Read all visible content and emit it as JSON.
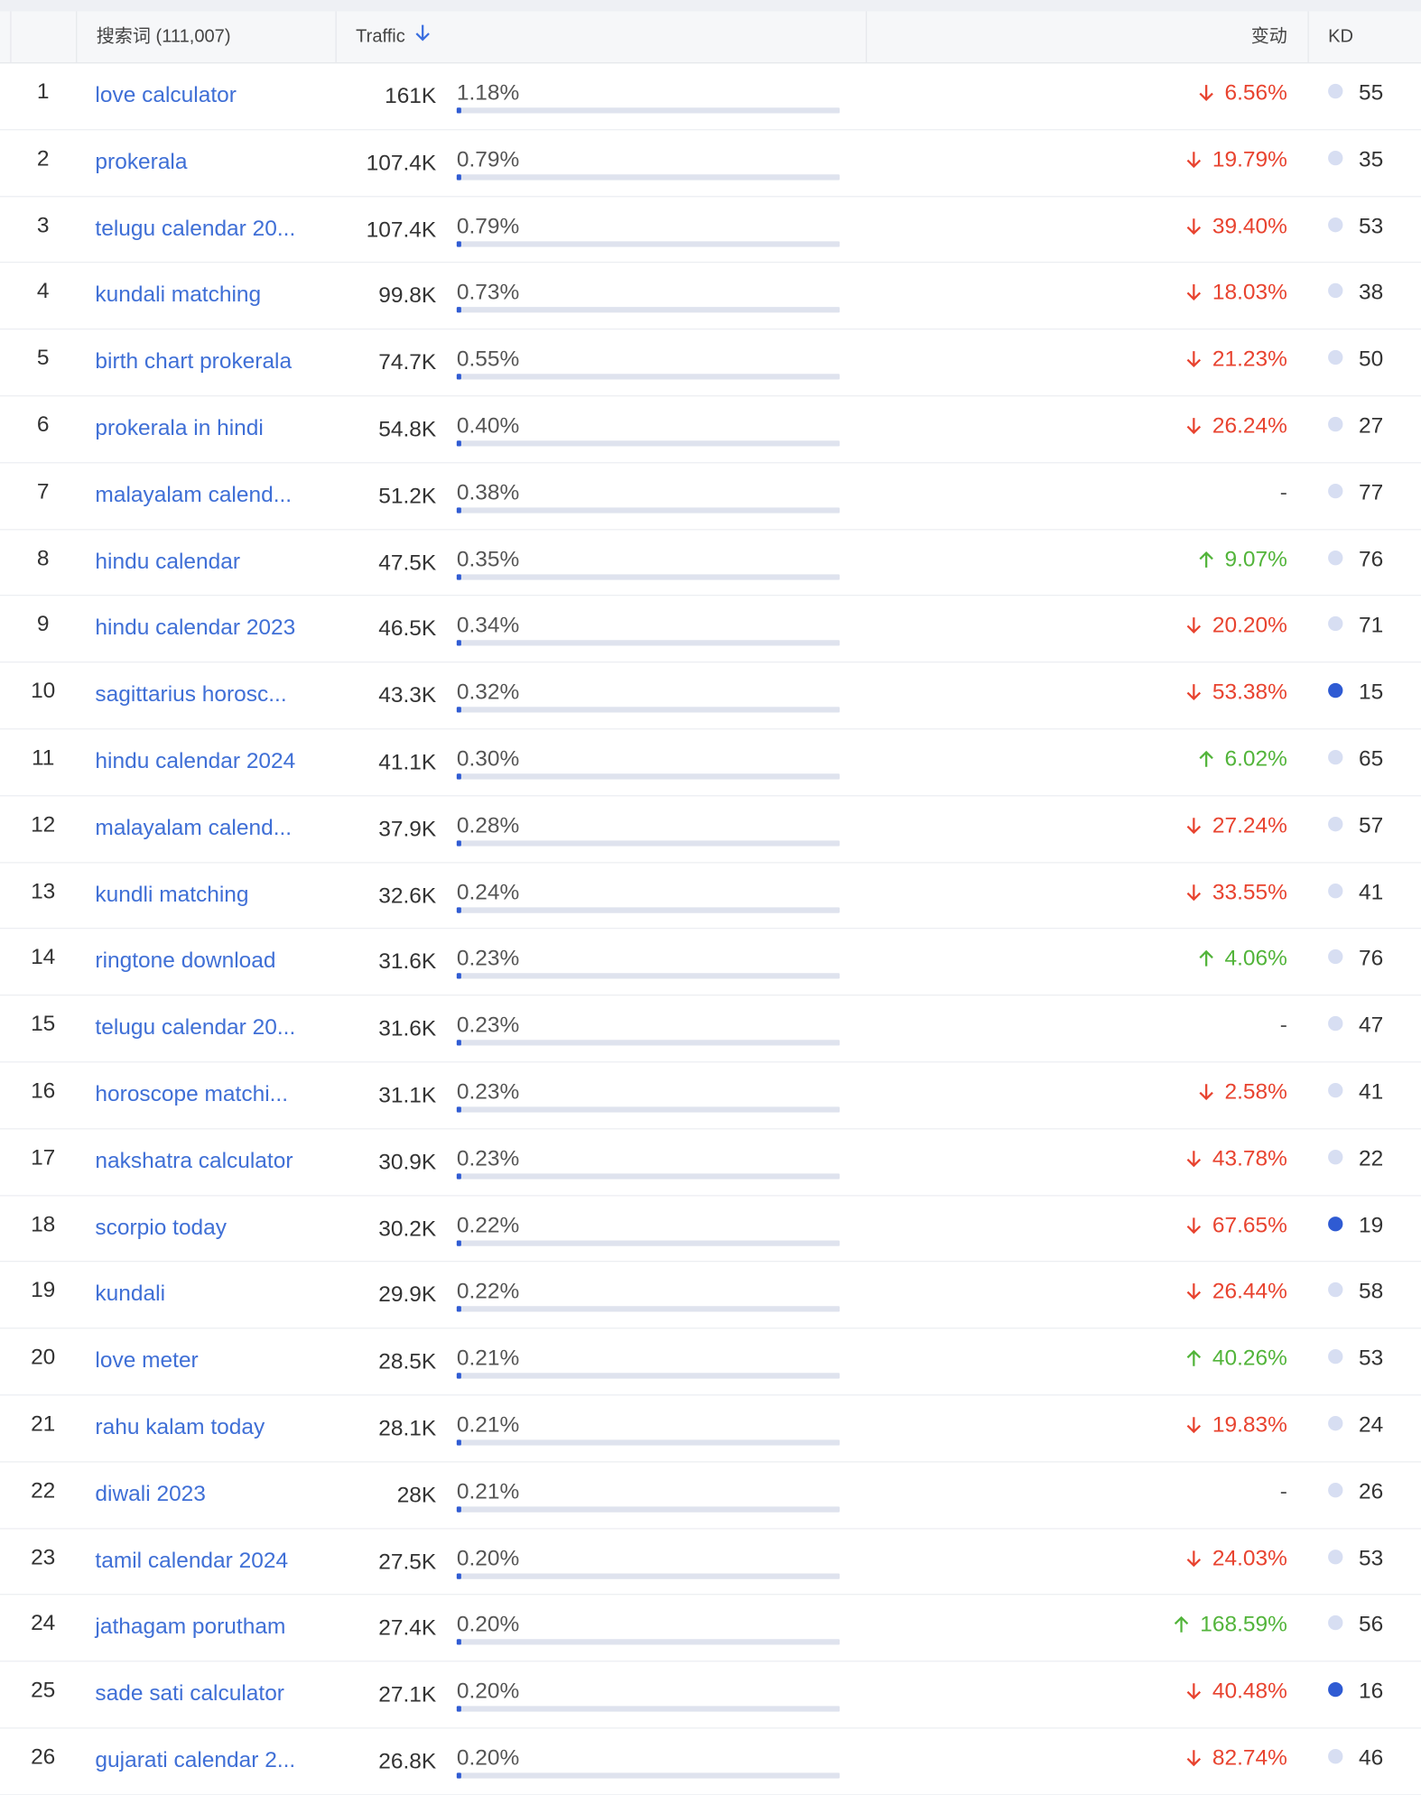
{
  "header": {
    "keyword_label": "搜索词 (111,007)",
    "traffic_label": "Traffic",
    "change_label": "变动",
    "kd_label": "KD"
  },
  "colors": {
    "link": "#3f6fd6",
    "down": "#e8432f",
    "up": "#52b43a",
    "bar": "#2f5bd3",
    "bar_track": "#dfe3ee",
    "kd_low": "#2f5bd3",
    "kd_mid": "#d7def2"
  },
  "rows": [
    {
      "num": "1",
      "keyword": "love calculator",
      "traffic": "161K",
      "pct": "1.18%",
      "share": 1.18,
      "dir": "down",
      "change": "6.56%",
      "kd": "55"
    },
    {
      "num": "2",
      "keyword": "prokerala",
      "traffic": "107.4K",
      "pct": "0.79%",
      "share": 0.79,
      "dir": "down",
      "change": "19.79%",
      "kd": "35"
    },
    {
      "num": "3",
      "keyword": "telugu calendar 20...",
      "traffic": "107.4K",
      "pct": "0.79%",
      "share": 0.79,
      "dir": "down",
      "change": "39.40%",
      "kd": "53"
    },
    {
      "num": "4",
      "keyword": "kundali matching",
      "traffic": "99.8K",
      "pct": "0.73%",
      "share": 0.73,
      "dir": "down",
      "change": "18.03%",
      "kd": "38"
    },
    {
      "num": "5",
      "keyword": "birth chart prokerala",
      "traffic": "74.7K",
      "pct": "0.55%",
      "share": 0.55,
      "dir": "down",
      "change": "21.23%",
      "kd": "50"
    },
    {
      "num": "6",
      "keyword": "prokerala in hindi",
      "traffic": "54.8K",
      "pct": "0.40%",
      "share": 0.4,
      "dir": "down",
      "change": "26.24%",
      "kd": "27"
    },
    {
      "num": "7",
      "keyword": "malayalam calend...",
      "traffic": "51.2K",
      "pct": "0.38%",
      "share": 0.38,
      "dir": "none",
      "change": "-",
      "kd": "77"
    },
    {
      "num": "8",
      "keyword": "hindu calendar",
      "traffic": "47.5K",
      "pct": "0.35%",
      "share": 0.35,
      "dir": "up",
      "change": "9.07%",
      "kd": "76"
    },
    {
      "num": "9",
      "keyword": "hindu calendar 2023",
      "traffic": "46.5K",
      "pct": "0.34%",
      "share": 0.34,
      "dir": "down",
      "change": "20.20%",
      "kd": "71"
    },
    {
      "num": "10",
      "keyword": "sagittarius horosc...",
      "traffic": "43.3K",
      "pct": "0.32%",
      "share": 0.32,
      "dir": "down",
      "change": "53.38%",
      "kd": "15"
    },
    {
      "num": "11",
      "keyword": "hindu calendar 2024",
      "traffic": "41.1K",
      "pct": "0.30%",
      "share": 0.3,
      "dir": "up",
      "change": "6.02%",
      "kd": "65"
    },
    {
      "num": "12",
      "keyword": "malayalam calend...",
      "traffic": "37.9K",
      "pct": "0.28%",
      "share": 0.28,
      "dir": "down",
      "change": "27.24%",
      "kd": "57"
    },
    {
      "num": "13",
      "keyword": "kundli matching",
      "traffic": "32.6K",
      "pct": "0.24%",
      "share": 0.24,
      "dir": "down",
      "change": "33.55%",
      "kd": "41"
    },
    {
      "num": "14",
      "keyword": "ringtone download",
      "traffic": "31.6K",
      "pct": "0.23%",
      "share": 0.23,
      "dir": "up",
      "change": "4.06%",
      "kd": "76"
    },
    {
      "num": "15",
      "keyword": "telugu calendar 20...",
      "traffic": "31.6K",
      "pct": "0.23%",
      "share": 0.23,
      "dir": "none",
      "change": "-",
      "kd": "47"
    },
    {
      "num": "16",
      "keyword": "horoscope matchi...",
      "traffic": "31.1K",
      "pct": "0.23%",
      "share": 0.23,
      "dir": "down",
      "change": "2.58%",
      "kd": "41"
    },
    {
      "num": "17",
      "keyword": "nakshatra calculator",
      "traffic": "30.9K",
      "pct": "0.23%",
      "share": 0.23,
      "dir": "down",
      "change": "43.78%",
      "kd": "22"
    },
    {
      "num": "18",
      "keyword": "scorpio today",
      "traffic": "30.2K",
      "pct": "0.22%",
      "share": 0.22,
      "dir": "down",
      "change": "67.65%",
      "kd": "19"
    },
    {
      "num": "19",
      "keyword": "kundali",
      "traffic": "29.9K",
      "pct": "0.22%",
      "share": 0.22,
      "dir": "down",
      "change": "26.44%",
      "kd": "58"
    },
    {
      "num": "20",
      "keyword": "love meter",
      "traffic": "28.5K",
      "pct": "0.21%",
      "share": 0.21,
      "dir": "up",
      "change": "40.26%",
      "kd": "53"
    },
    {
      "num": "21",
      "keyword": "rahu kalam today",
      "traffic": "28.1K",
      "pct": "0.21%",
      "share": 0.21,
      "dir": "down",
      "change": "19.83%",
      "kd": "24"
    },
    {
      "num": "22",
      "keyword": "diwali 2023",
      "traffic": "28K",
      "pct": "0.21%",
      "share": 0.21,
      "dir": "none",
      "change": "-",
      "kd": "26"
    },
    {
      "num": "23",
      "keyword": "tamil calendar 2024",
      "traffic": "27.5K",
      "pct": "0.20%",
      "share": 0.2,
      "dir": "down",
      "change": "24.03%",
      "kd": "53"
    },
    {
      "num": "24",
      "keyword": "jathagam porutham",
      "traffic": "27.4K",
      "pct": "0.20%",
      "share": 0.2,
      "dir": "up",
      "change": "168.59%",
      "kd": "56"
    },
    {
      "num": "25",
      "keyword": "sade sati calculator",
      "traffic": "27.1K",
      "pct": "0.20%",
      "share": 0.2,
      "dir": "down",
      "change": "40.48%",
      "kd": "16"
    },
    {
      "num": "26",
      "keyword": "gujarati calendar 2...",
      "traffic": "26.8K",
      "pct": "0.20%",
      "share": 0.2,
      "dir": "down",
      "change": "82.74%",
      "kd": "46"
    }
  ]
}
